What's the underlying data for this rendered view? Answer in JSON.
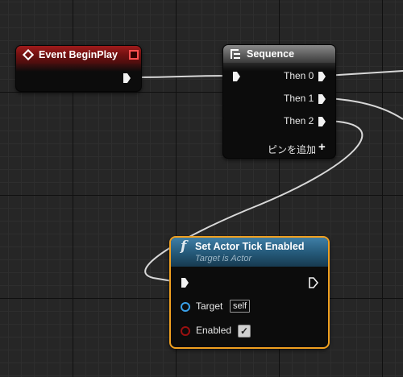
{
  "nodes": {
    "event_begin_play": {
      "title": "Event BeginPlay",
      "icon": "event-diamond-icon",
      "header_color": "#8a1616"
    },
    "sequence": {
      "title": "Sequence",
      "icon": "sequence-icon",
      "outputs": [
        "Then 0",
        "Then 1",
        "Then 2"
      ],
      "add_pin_label": "ピンを追加"
    },
    "set_actor_tick_enabled": {
      "title": "Set Actor Tick Enabled",
      "subtitle": "Target is Actor",
      "icon": "function-icon",
      "header_color": "#2b6a8f",
      "selected_outline_color": "#f0a020",
      "target_label": "Target",
      "target_value": "self",
      "enabled_label": "Enabled",
      "enabled_checked": true
    }
  }
}
